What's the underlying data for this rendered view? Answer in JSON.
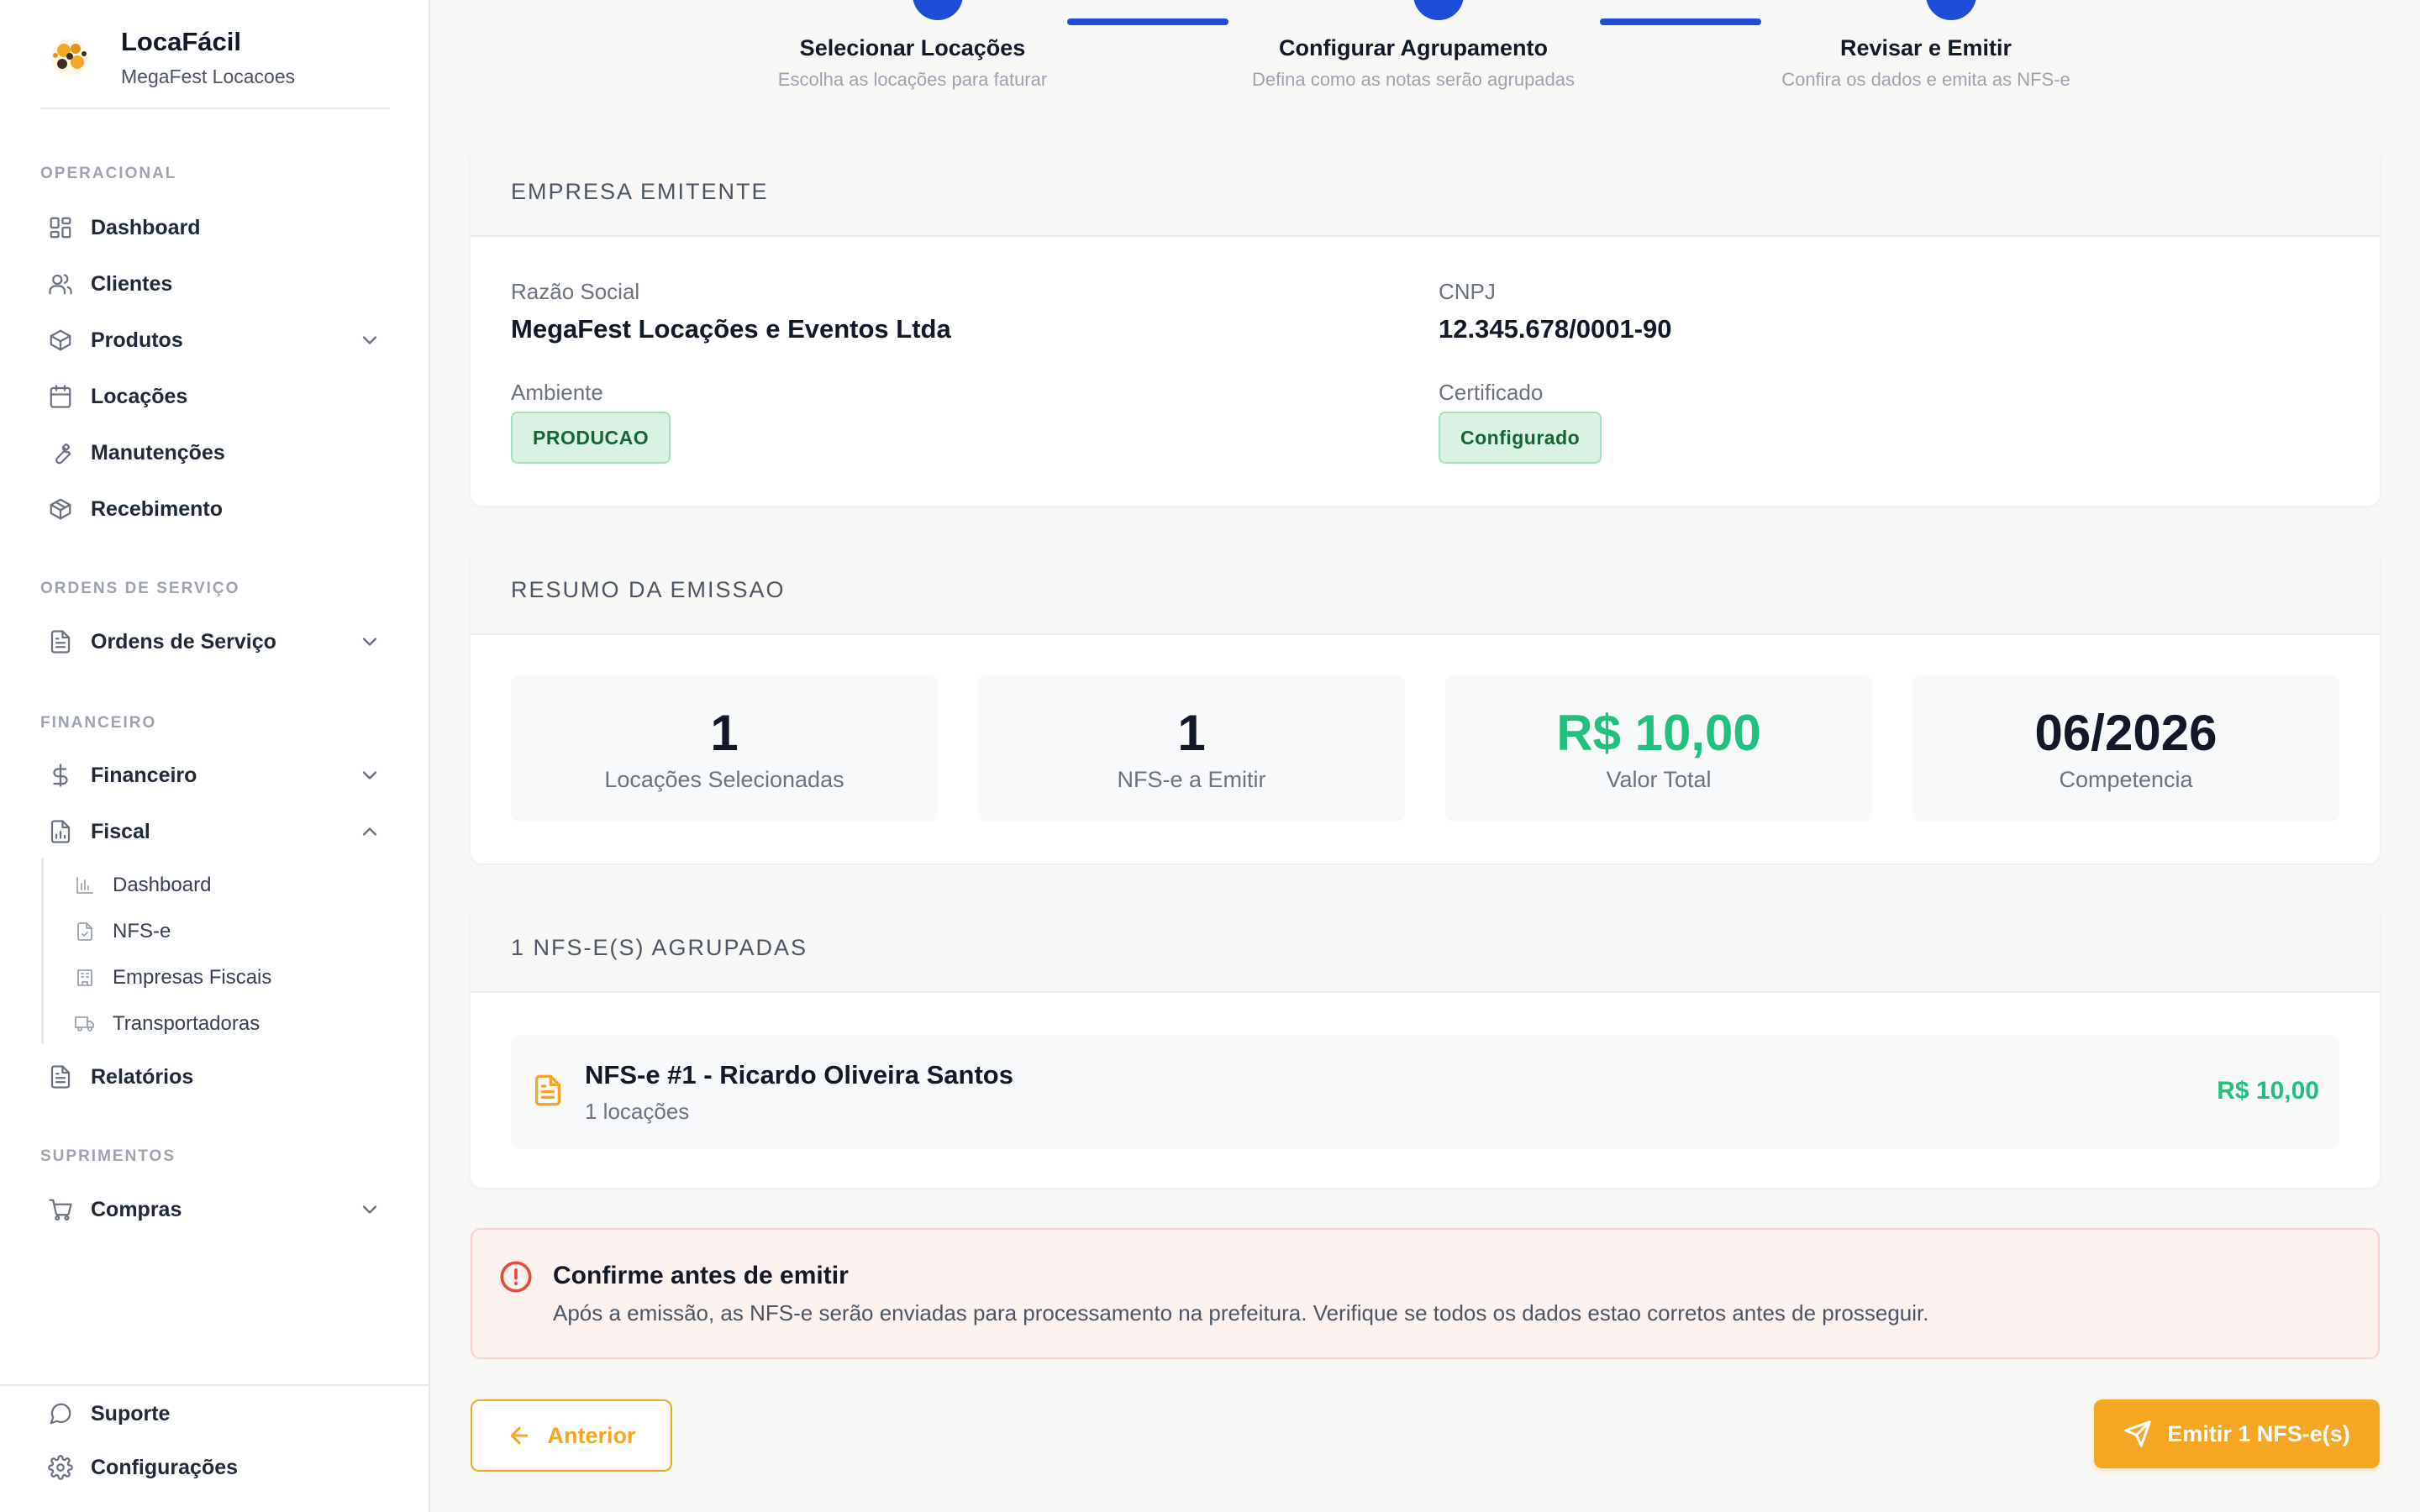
{
  "brand": {
    "name": "LocaFácil",
    "company": "MegaFest Locacoes"
  },
  "sidebar": {
    "sections": {
      "operacional": "OPERACIONAL",
      "ordens": "ORDENS DE SERVIÇO",
      "financeiro": "FINANCEIRO",
      "suprimentos": "SUPRIMENTOS"
    },
    "items": {
      "dashboard": "Dashboard",
      "clientes": "Clientes",
      "produtos": "Produtos",
      "locacoes": "Locações",
      "manutencoes": "Manutenções",
      "recebimento": "Recebimento",
      "ordens_servico": "Ordens de Serviço",
      "financeiro": "Financeiro",
      "fiscal": "Fiscal",
      "relatorios": "Relatórios",
      "compras": "Compras",
      "suporte": "Suporte",
      "configuracoes": "Configurações"
    },
    "fiscal_sub": {
      "dashboard": "Dashboard",
      "nfse": "NFS-e",
      "empresas": "Empresas Fiscais",
      "transportadoras": "Transportadoras"
    }
  },
  "stepper": [
    {
      "title": "Selecionar Locações",
      "subtitle": "Escolha as locações para faturar"
    },
    {
      "title": "Configurar Agrupamento",
      "subtitle": "Defina como as notas serão agrupadas"
    },
    {
      "title": "Revisar e Emitir",
      "subtitle": "Confira os dados e emita as NFS-e"
    }
  ],
  "empresa": {
    "heading": "EMPRESA EMITENTE",
    "razao_label": "Razão Social",
    "razao_value": "MegaFest Locações e Eventos Ltda",
    "cnpj_label": "CNPJ",
    "cnpj_value": "12.345.678/0001-90",
    "ambiente_label": "Ambiente",
    "ambiente_value": "PRODUCAO",
    "certificado_label": "Certificado",
    "certificado_value": "Configurado"
  },
  "resumo": {
    "heading": "RESUMO DA EMISSAO",
    "stats": [
      {
        "value": "1",
        "caption": "Locações Selecionadas"
      },
      {
        "value": "1",
        "caption": "NFS-e a Emitir"
      },
      {
        "value": "R$ 10,00",
        "caption": "Valor Total"
      },
      {
        "value": "06/2026",
        "caption": "Competencia"
      }
    ]
  },
  "agrupadas": {
    "heading": "1 NFS-E(S) AGRUPADAS",
    "items": [
      {
        "title": "NFS-e #1 - Ricardo Oliveira Santos",
        "subtitle": "1 locações",
        "value": "R$ 10,00"
      }
    ]
  },
  "alert": {
    "title": "Confirme antes de emitir",
    "message": "Após a emissão, as NFS-e serão enviadas para processamento na prefeitura. Verifique se todos os dados estao corretos antes de prosseguir."
  },
  "actions": {
    "previous": "Anterior",
    "emit": "Emitir 1 NFS-e(s)"
  },
  "colors": {
    "accent": "#f5a623",
    "primary": "#1d4ed8",
    "success": "#22c07e",
    "danger": "#e74c3c"
  }
}
